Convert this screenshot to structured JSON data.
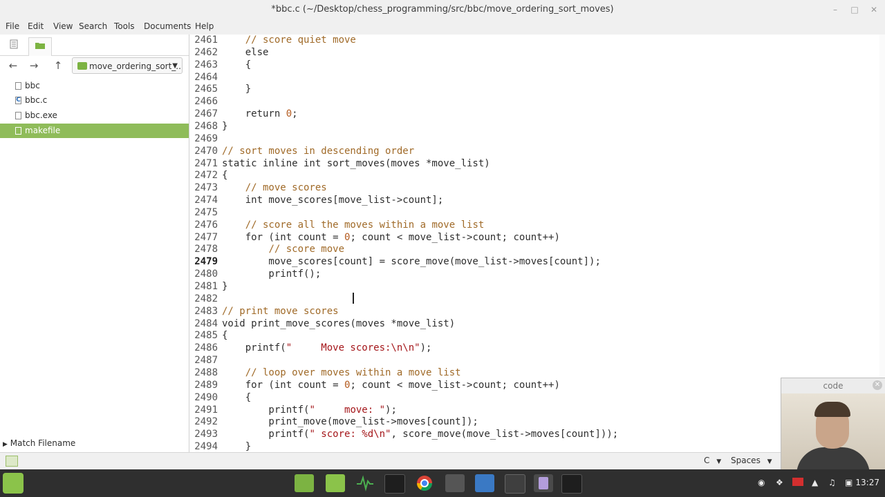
{
  "window": {
    "title": "*bbc.c (~/Desktop/chess_programming/src/bbc/move_ordering_sort_moves)"
  },
  "menu": [
    "File",
    "Edit",
    "View",
    "Search",
    "Tools",
    "Documents",
    "Help"
  ],
  "side_panel": {
    "folder": "move_ordering_sort_...",
    "files": [
      {
        "name": "bbc",
        "selected": false
      },
      {
        "name": "bbc.c",
        "selected": false
      },
      {
        "name": "bbc.exe",
        "selected": false
      },
      {
        "name": "makefile",
        "selected": true
      }
    ],
    "match_filename": "Match Filename"
  },
  "editor": {
    "current_line": "2479",
    "lines": [
      {
        "n": "2461",
        "t": "    // score quiet move"
      },
      {
        "n": "2462",
        "t": "    else"
      },
      {
        "n": "2463",
        "t": "    {"
      },
      {
        "n": "2464",
        "t": "        "
      },
      {
        "n": "2465",
        "t": "    }"
      },
      {
        "n": "2466",
        "t": "    "
      },
      {
        "n": "2467",
        "t": "    return 0;"
      },
      {
        "n": "2468",
        "t": "}"
      },
      {
        "n": "2469",
        "t": ""
      },
      {
        "n": "2470",
        "t": "// sort moves in descending order"
      },
      {
        "n": "2471",
        "t": "static inline int sort_moves(moves *move_list)"
      },
      {
        "n": "2472",
        "t": "{"
      },
      {
        "n": "2473",
        "t": "    // move scores"
      },
      {
        "n": "2474",
        "t": "    int move_scores[move_list->count];"
      },
      {
        "n": "2475",
        "t": "    "
      },
      {
        "n": "2476",
        "t": "    // score all the moves within a move list"
      },
      {
        "n": "2477",
        "t": "    for (int count = 0; count < move_list->count; count++)"
      },
      {
        "n": "2478",
        "t": "        // score move"
      },
      {
        "n": "2479",
        "t": "        move_scores[count] = score_move(move_list->moves[count]);"
      },
      {
        "n": "2480",
        "t": "        printf();"
      },
      {
        "n": "2481",
        "t": "}"
      },
      {
        "n": "2482",
        "t": ""
      },
      {
        "n": "2483",
        "t": "// print move scores"
      },
      {
        "n": "2484",
        "t": "void print_move_scores(moves *move_list)"
      },
      {
        "n": "2485",
        "t": "{"
      },
      {
        "n": "2486",
        "t": "    printf(\"     Move scores:\\n\\n\");"
      },
      {
        "n": "2487",
        "t": "    "
      },
      {
        "n": "2488",
        "t": "    // loop over moves within a move list"
      },
      {
        "n": "2489",
        "t": "    for (int count = 0; count < move_list->count; count++)"
      },
      {
        "n": "2490",
        "t": "    {"
      },
      {
        "n": "2491",
        "t": "        printf(\"     move: \");"
      },
      {
        "n": "2492",
        "t": "        print_move(move_list->moves[count]);"
      },
      {
        "n": "2493",
        "t": "        printf(\" score: %d\\n\", score_move(move_list->moves[count]));"
      },
      {
        "n": "2494",
        "t": "    }"
      }
    ]
  },
  "statusbar": {
    "language": "C",
    "indent": "Spaces"
  },
  "webcam": {
    "title": "code"
  },
  "taskbar": {
    "clock": "13:27"
  }
}
